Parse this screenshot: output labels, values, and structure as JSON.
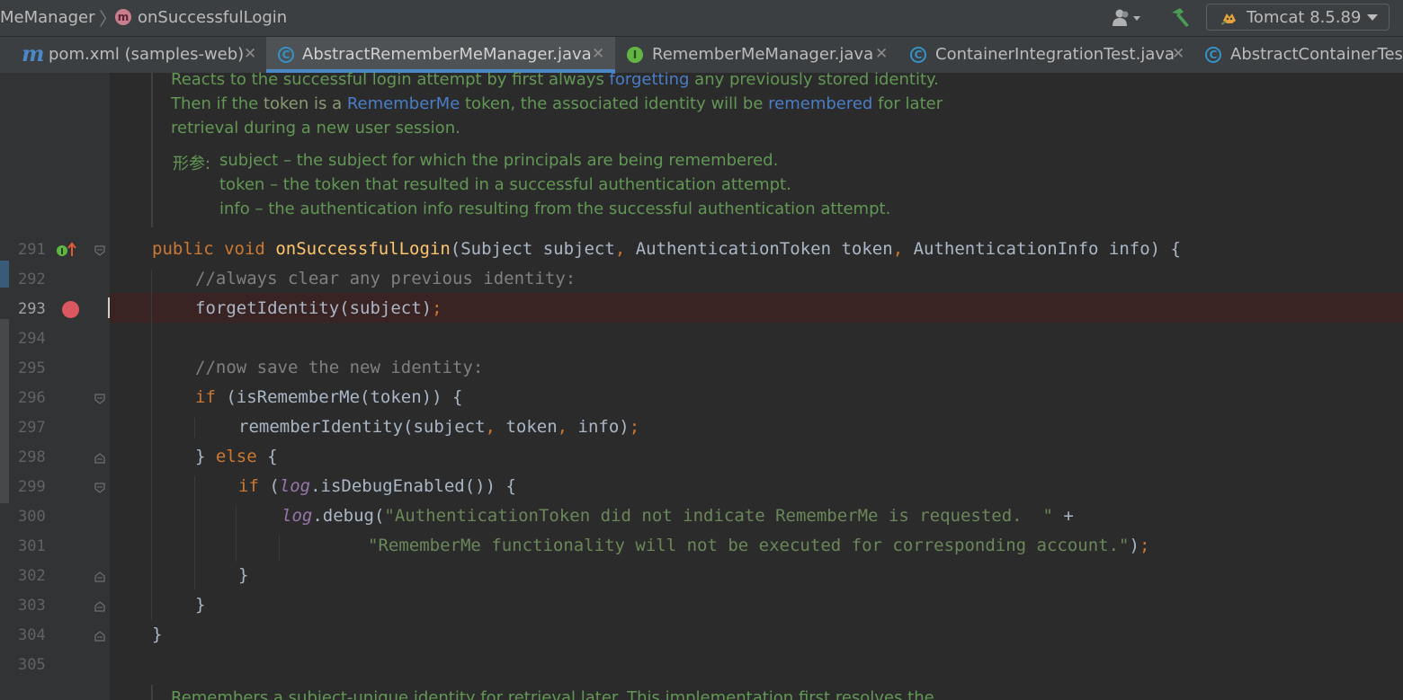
{
  "breadcrumb": {
    "item1": "MeManager",
    "item2_badge": "m",
    "item2": "onSuccessfulLogin"
  },
  "toolbar": {
    "run_config": "Tomcat 8.5.89"
  },
  "tabs": [
    {
      "icon": "m",
      "label": "pom.xml (samples-web)",
      "active": false
    },
    {
      "icon": "C",
      "label": "AbstractRememberMeManager.java",
      "active": true
    },
    {
      "icon": "I",
      "label": "RememberMeManager.java",
      "active": false
    },
    {
      "icon": "C",
      "label": "ContainerIntegrationTest.java",
      "active": false
    },
    {
      "icon": "C",
      "label": "AbstractContainerTest",
      "active": false
    }
  ],
  "doc": {
    "l1a": "Reacts to the successful login attempt by first always ",
    "l1b": "forgetting",
    "l1c": " any previously stored identity.",
    "l2a": "Then if the ",
    "l2b": "token",
    "l2c": " is a ",
    "l2d": "RememberMe",
    "l2e": " token, the associated identity will be ",
    "l2f": "remembered",
    "l2g": " for later",
    "l3": "retrieval during a new user session.",
    "params_label": "形参:",
    "p1_name": "subject",
    "p1_desc": " – the subject for which the principals are being remembered.",
    "p2_name": "token",
    "p2_desc": " – the token that resulted in a successful authentication attempt.",
    "p3_name": "info",
    "p3_desc": " – the authentication info resulting from the successful authentication attempt."
  },
  "line_numbers": [
    "291",
    "292",
    "293",
    "294",
    "295",
    "296",
    "297",
    "298",
    "299",
    "300",
    "301",
    "302",
    "303",
    "304",
    "305"
  ],
  "code": {
    "l291_kw1": "public",
    "l291_kw2": "void",
    "l291_fn": "onSuccessfulLogin",
    "l291_p1": "(Subject subject",
    "l291_c1": ",",
    "l291_p2": " AuthenticationToken token",
    "l291_c2": ",",
    "l291_p3": " AuthenticationInfo info) {",
    "l292": "//always clear any previous identity:",
    "l293a": "forgetIdentity(subject)",
    "l293b": ";",
    "l295": "//now save the new identity:",
    "l296_kw": "if",
    "l296_rest": " (isRememberMe(token)) {",
    "l297a": "rememberIdentity(subject",
    "l297b": ",",
    "l297c": " token",
    "l297d": ",",
    "l297e": " info)",
    "l297f": ";",
    "l298a": "} ",
    "l298_kw": "else",
    "l298b": " {",
    "l299_kw": "if",
    "l299a": " (",
    "l299_fld": "log",
    "l299b": ".isDebugEnabled()) {",
    "l300_fld": "log",
    "l300a": ".debug(",
    "l300_str": "\"AuthenticationToken did not indicate RememberMe is requested.  \"",
    "l300b": " +",
    "l301_str": "\"RememberMe functionality will not be executed for corresponding account.\"",
    "l301a": ")",
    "l301b": ";",
    "l302": "}",
    "l303": "}",
    "l304": "}"
  },
  "doc_cutoff": "Remembers a subject-unique identity for retrieval later. This implementation first resolves the"
}
